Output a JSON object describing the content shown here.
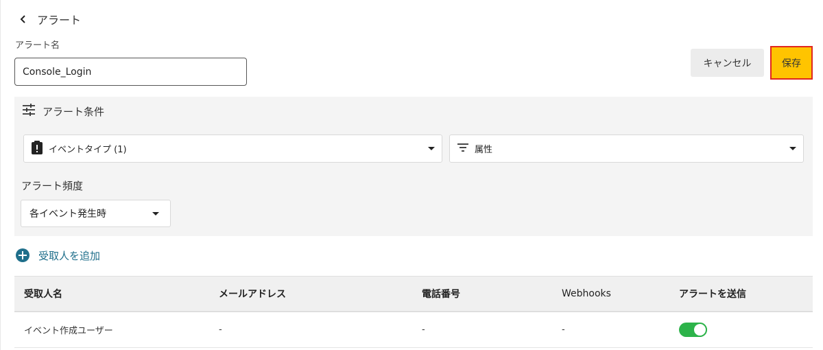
{
  "header": {
    "back_title": "アラート"
  },
  "alert_name": {
    "label": "アラート名",
    "value": "Console_Login"
  },
  "actions": {
    "cancel_label": "キャンセル",
    "save_label": "保存"
  },
  "conditions": {
    "title": "アラート条件",
    "event_type_dropdown": "イベントタイプ (1)",
    "attribute_dropdown": "属性",
    "frequency_label": "アラート頻度",
    "frequency_value": "各イベント発生時"
  },
  "add_recipient_label": "受取人を追加",
  "recipients_table": {
    "columns": [
      "受取人名",
      "メールアドレス",
      "電話番号",
      "Webhooks",
      "アラートを送信"
    ],
    "rows": [
      {
        "name": "イベント作成ユーザー",
        "email": "-",
        "phone": "-",
        "webhooks": "-",
        "send_alert": true
      }
    ]
  },
  "colors": {
    "primary": "#ffc400",
    "accent": "#1f6f8b",
    "toggle_on": "#2db34a",
    "highlight_border": "#e0261f"
  }
}
